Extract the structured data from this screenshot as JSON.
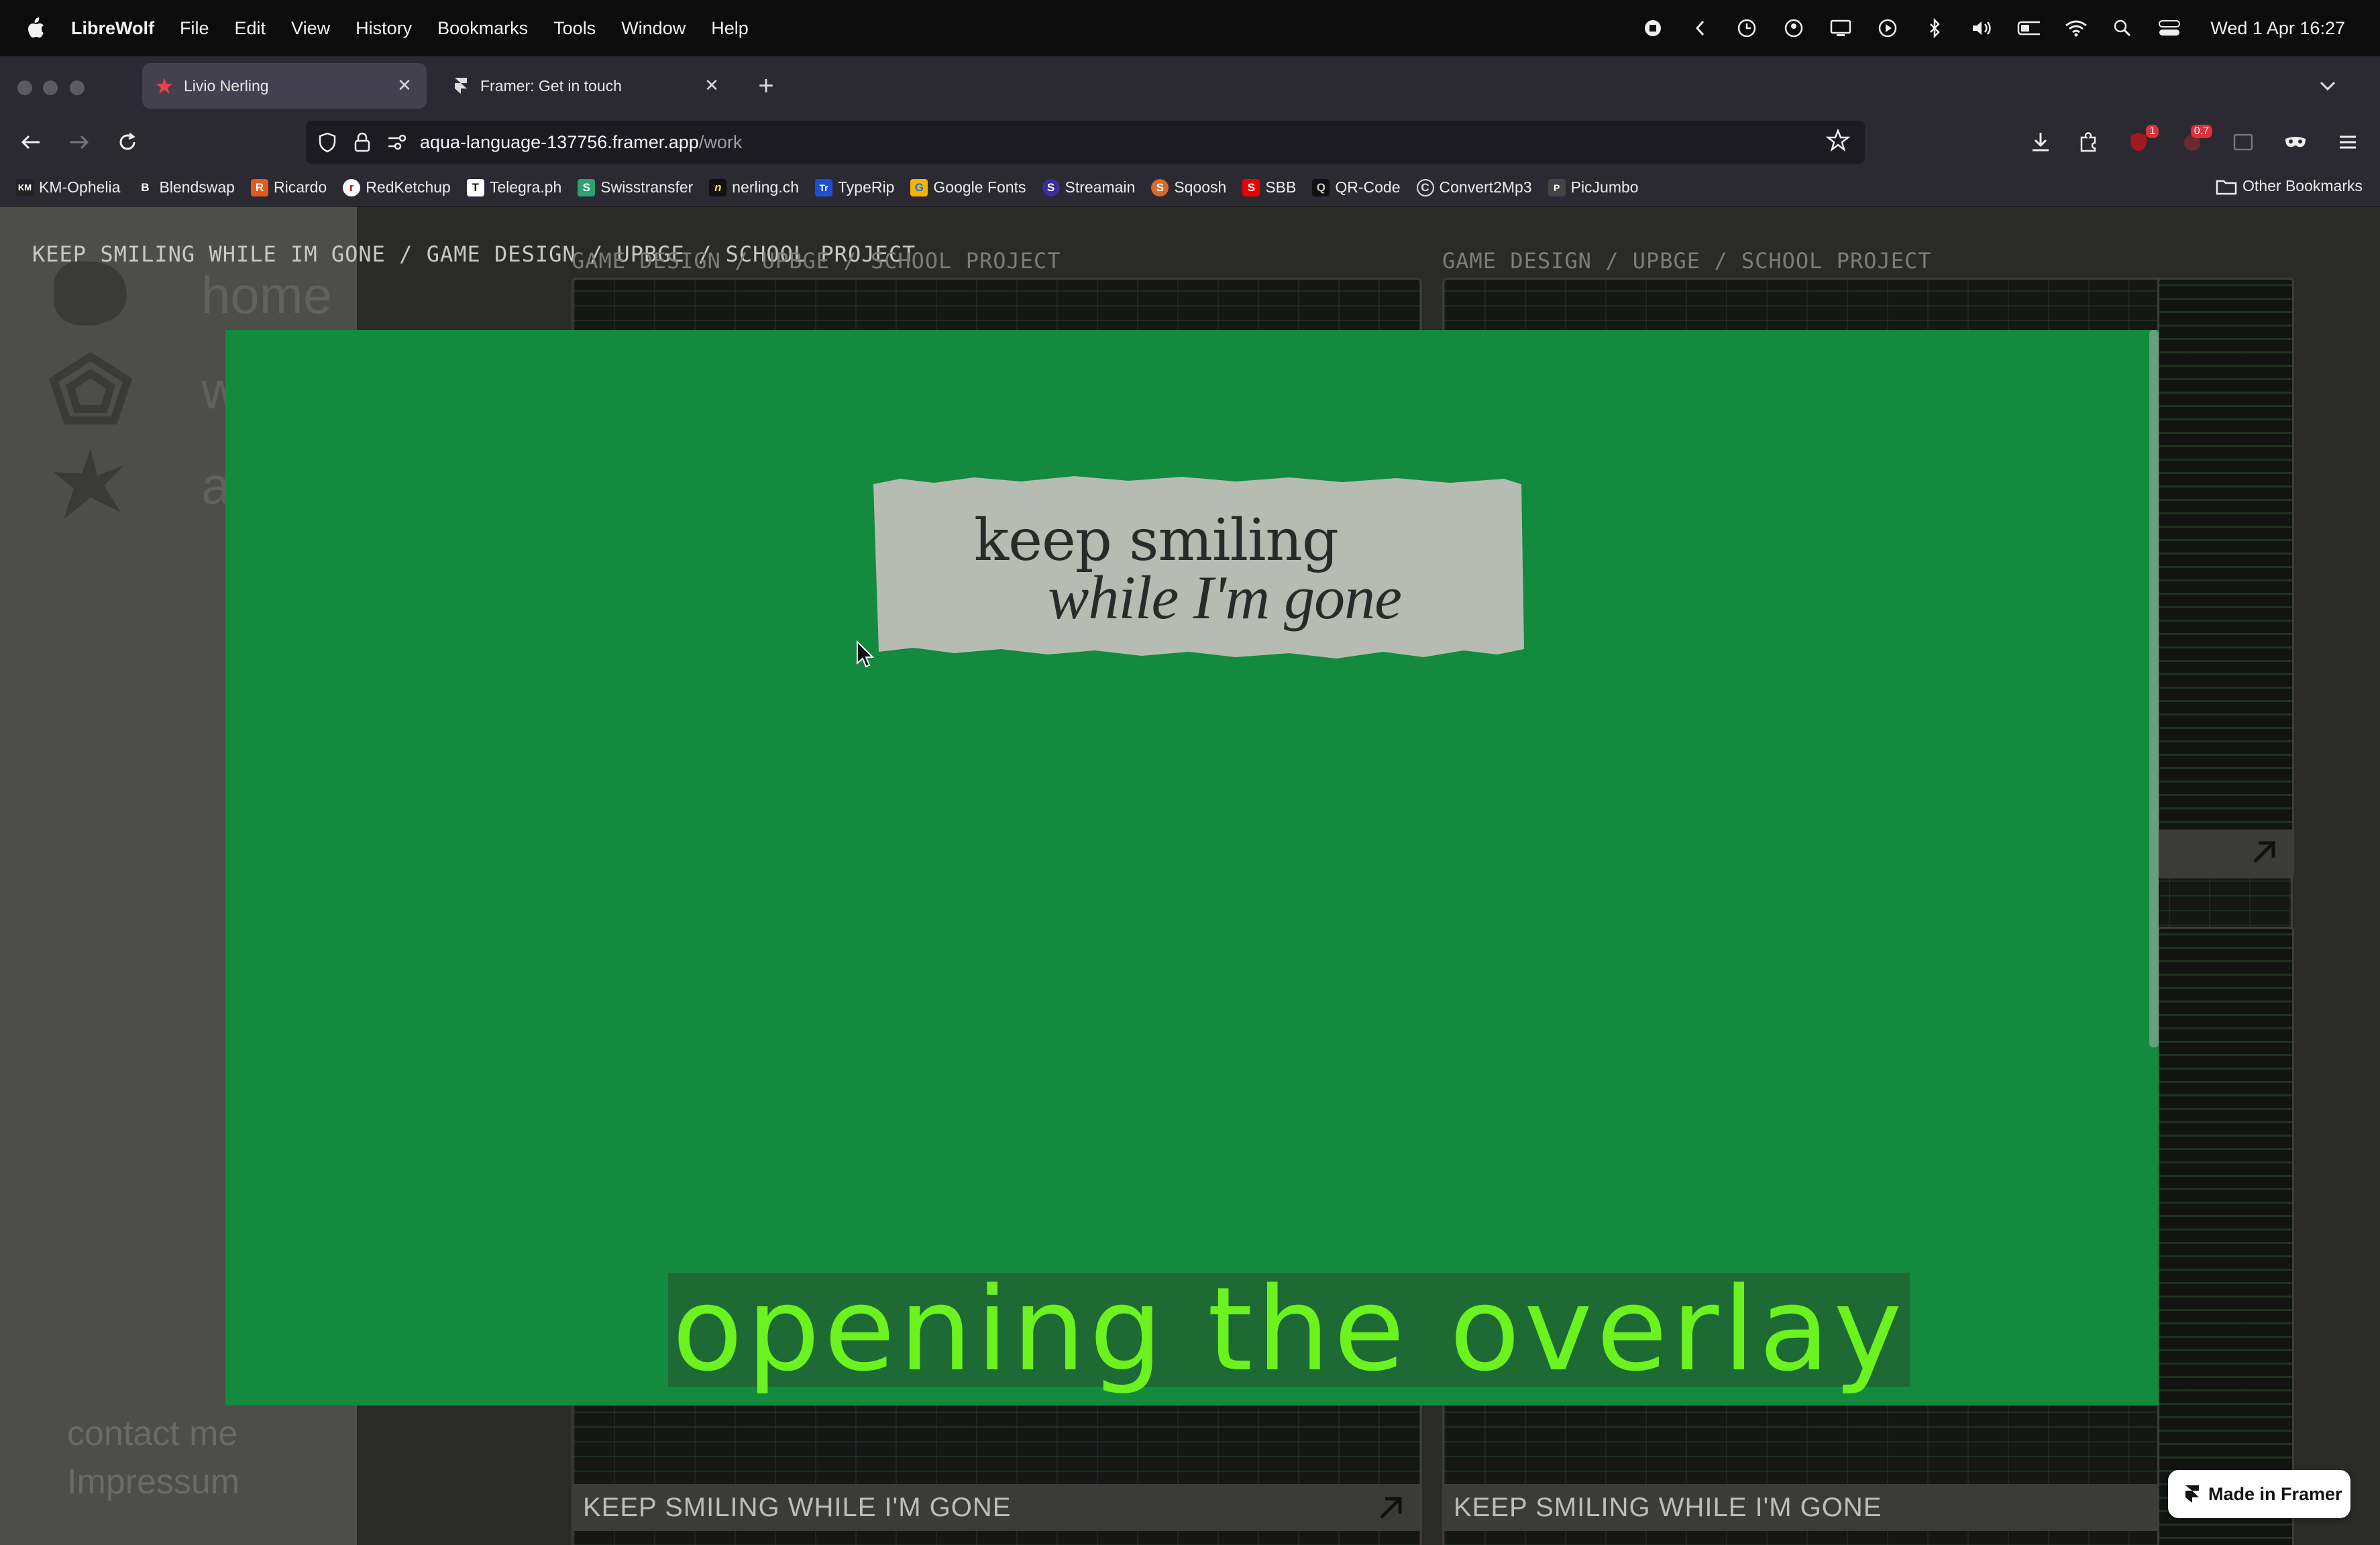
{
  "menubar": {
    "app": "LibreWolf",
    "items": [
      "File",
      "Edit",
      "View",
      "History",
      "Bookmarks",
      "Tools",
      "Window",
      "Help"
    ],
    "clock": "Wed 1 Apr  16:27"
  },
  "tabs": [
    {
      "title": "Livio Nerling",
      "active": true
    },
    {
      "title": "Framer: Get in touch",
      "active": false
    }
  ],
  "address": {
    "host": "aqua-language-137756.framer.app",
    "path": "/work"
  },
  "extension_badges": {
    "first": "1",
    "second": "0.7"
  },
  "bookmarks": [
    {
      "label": "KM-Ophelia",
      "icon": "KM"
    },
    {
      "label": "Blendswap",
      "icon": "B"
    },
    {
      "label": "Ricardo",
      "icon": "R"
    },
    {
      "label": "RedKetchup",
      "icon": "r"
    },
    {
      "label": "Telegra.ph",
      "icon": "T"
    },
    {
      "label": "Swisstransfer",
      "icon": "S"
    },
    {
      "label": "nerling.ch",
      "icon": "n"
    },
    {
      "label": "TypeRip",
      "icon": "Tr"
    },
    {
      "label": "Google Fonts",
      "icon": "G"
    },
    {
      "label": "Streamain",
      "icon": "S"
    },
    {
      "label": "Sqoosh",
      "icon": "S"
    },
    {
      "label": "SBB",
      "icon": "S"
    },
    {
      "label": "QR-Code",
      "icon": "Q"
    },
    {
      "label": "Convert2Mp3",
      "icon": "C"
    },
    {
      "label": "PicJumbo",
      "icon": "P"
    }
  ],
  "other_bookmarks": "Other Bookmarks",
  "sidebar": {
    "nav": [
      {
        "label": "home"
      },
      {
        "label": "wo"
      },
      {
        "label": "abo"
      }
    ],
    "contact": "contact me",
    "impressum": "Impressum"
  },
  "breadcrumb_top": {
    "title": "KEEP SMILING WHILE IM GONE",
    "path": "/ GAME DESIGN / UPBGE / SCHOOL PROJECT"
  },
  "cards": [
    {
      "tags": "GAME DESIGN / UPBGE / SCHOOL PROJECT",
      "caption": "KEEP SMILING WHILE I'M GONE"
    },
    {
      "tags": "GAME DESIGN / UPBGE / SCHOOL PROJECT",
      "caption": "KEEP SMILING WHILE I'M GONE"
    }
  ],
  "overlay": {
    "paper_line1": "keep smiling",
    "paper_line2": "while I'm gone",
    "subtitle": "opening the overlay",
    "color": "#138a3d"
  },
  "badge_framer": "Made in Framer"
}
